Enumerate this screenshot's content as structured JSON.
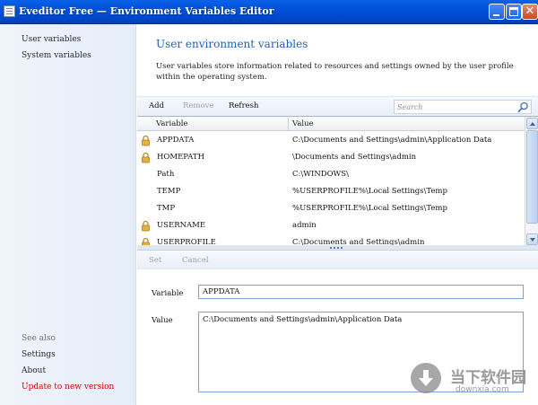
{
  "window": {
    "title": "Eveditor Free — Environment Variables Editor",
    "controls": [
      "minimize-icon",
      "maximize-icon",
      "close-icon"
    ]
  },
  "sidebar": {
    "items": [
      {
        "label": "User variables"
      },
      {
        "label": "System variables"
      }
    ],
    "see_also_label": "See also",
    "links": [
      {
        "label": "Settings"
      },
      {
        "label": "About"
      },
      {
        "label": "Update to new version",
        "color": "#d80000"
      }
    ]
  },
  "main": {
    "title": "User environment variables",
    "description": "User variables store information related to resources and settings owned by the user profile within the operating system.",
    "accent_color": "#1f5fb8"
  },
  "toolbar": {
    "add_label": "Add",
    "remove_label": "Remove",
    "refresh_label": "Refresh",
    "search_placeholder": "Search",
    "search_icon": "magnifier-icon"
  },
  "table": {
    "columns": [
      "Variable",
      "Value"
    ],
    "rows": [
      {
        "locked": true,
        "variable": "APPDATA",
        "value": "C:\\Documents and Settings\\admin\\Application Data"
      },
      {
        "locked": true,
        "variable": "HOMEPATH",
        "value": "\\Documents and Settings\\admin"
      },
      {
        "locked": false,
        "variable": "Path",
        "value": "C:\\WINDOWS\\"
      },
      {
        "locked": false,
        "variable": "TEMP",
        "value": "%USERPROFILE%\\Local Settings\\Temp"
      },
      {
        "locked": false,
        "variable": "TMP",
        "value": "%USERPROFILE%\\Local Settings\\Temp"
      },
      {
        "locked": true,
        "variable": "USERNAME",
        "value": "admin"
      },
      {
        "locked": true,
        "variable": "USERPROFILE",
        "value": "C:\\Documents and Settings\\admin"
      }
    ],
    "selected_row": 0
  },
  "edit_toolbar": {
    "set_label": "Set",
    "cancel_label": "Cancel"
  },
  "editor": {
    "variable_label": "Variable",
    "variable_value": "APPDATA",
    "value_label": "Value",
    "value_value": "C:\\Documents and Settings\\admin\\Application Data"
  },
  "watermark": {
    "name": "当下软件园",
    "url": "downxia.com"
  }
}
